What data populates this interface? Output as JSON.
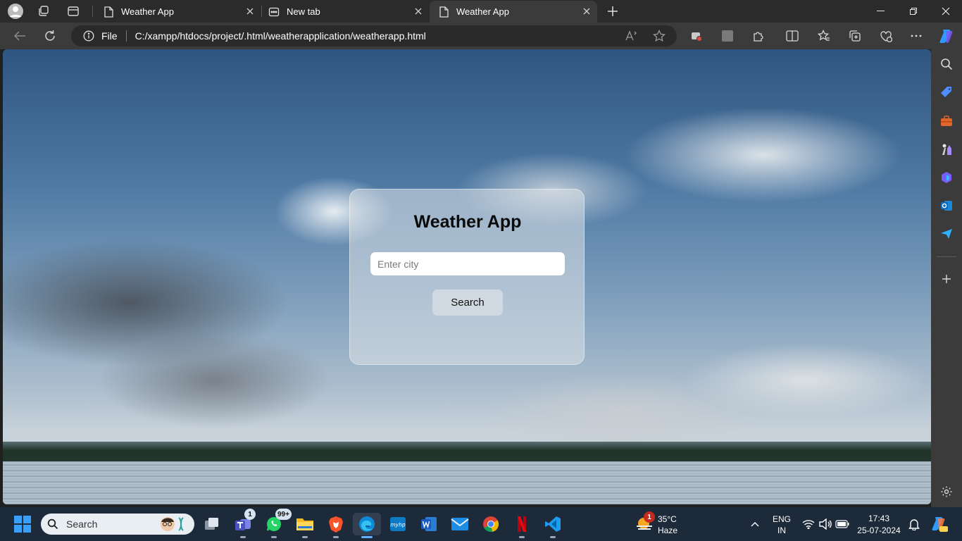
{
  "browser": {
    "tabs": [
      {
        "title": "Weather App"
      },
      {
        "title": "New tab"
      },
      {
        "title": "Weather App"
      }
    ],
    "address": {
      "scheme_label": "File",
      "url": "C:/xampp/htdocs/project/.html/weatherapplication/weatherapp.html"
    }
  },
  "page": {
    "title": "Weather App",
    "city_input": {
      "placeholder": "Enter city",
      "value": ""
    },
    "search_button": "Search"
  },
  "taskbar": {
    "search_label": "Search",
    "badges": {
      "teams": "1",
      "whatsapp": "99+",
      "weather": "1"
    },
    "weather": {
      "temp": "35°C",
      "condition": "Haze"
    },
    "language": {
      "line1": "ENG",
      "line2": "IN"
    },
    "clock": {
      "time": "17:43",
      "date": "25-07-2024"
    }
  },
  "colors": {
    "tab_strip": "#2b2b2b",
    "toolbar": "#3b3b3b",
    "taskbar": "#1c2a3a",
    "accent": "#3aa0ff"
  }
}
